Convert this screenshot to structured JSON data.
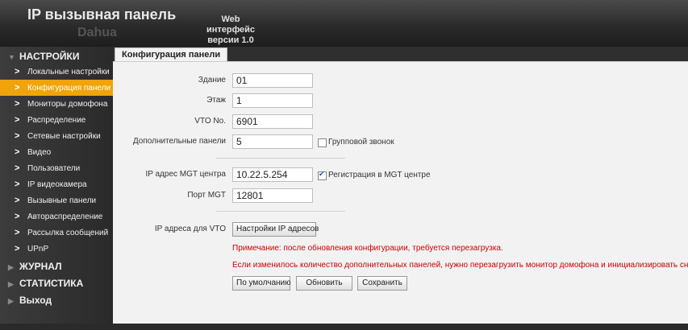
{
  "header": {
    "title": "IP вызывная панель",
    "brand": "Dahua",
    "web_line1": "Web интерфейс",
    "web_line2": "версии 1.0"
  },
  "sidebar": {
    "groups": [
      {
        "label": "НАСТРОЙКИ"
      },
      {
        "label": "ЖУРНАЛ"
      },
      {
        "label": "СТАТИСТИКА"
      },
      {
        "label": "Выход"
      }
    ],
    "items": [
      {
        "label": "Локальные настройки"
      },
      {
        "label": "Конфигурация панели"
      },
      {
        "label": "Мониторы домофона"
      },
      {
        "label": "Распределение"
      },
      {
        "label": "Сетевые настройки"
      },
      {
        "label": "Видео"
      },
      {
        "label": "Пользователи"
      },
      {
        "label": "IP видеокамера"
      },
      {
        "label": "Вызывные панели"
      },
      {
        "label": "Автораспределение"
      },
      {
        "label": "Рассылка сообщений"
      },
      {
        "label": "UPnP"
      }
    ]
  },
  "tab": {
    "label": "Конфигурация панели"
  },
  "form": {
    "building_label": "Здание",
    "building_value": "01",
    "floor_label": "Этаж",
    "floor_value": "1",
    "vto_label": "VTO No.",
    "vto_value": "6901",
    "extra_panels_label": "Дополнительные панели",
    "extra_panels_value": "5",
    "group_call_label": "Групповой звонок",
    "group_call_checked": false,
    "mgt_ip_label": "IP адрес MGT центра",
    "mgt_ip_value": "10.22.5.254",
    "mgt_reg_label": "Регистрация в MGT центре",
    "mgt_reg_checked": true,
    "mgt_port_label": "Порт MGT",
    "mgt_port_value": "12801",
    "vto_ip_label": "IP адреса для VTO",
    "vto_ip_button": "Настройки IP адресов",
    "note1": "Примечание: после обновления конфигурации, требуется перезагрузка.",
    "note2": "Если изменилось количество дополнительных панелей, нужно перезагрузить монитор домофона и инициализировать снова!",
    "btn_default": "По умолчанию",
    "btn_refresh": "Обновить",
    "btn_save": "Сохранить"
  },
  "colors": {
    "accent": "#f0a30a",
    "warning": "#d00000",
    "header": "#2b2b2b"
  }
}
